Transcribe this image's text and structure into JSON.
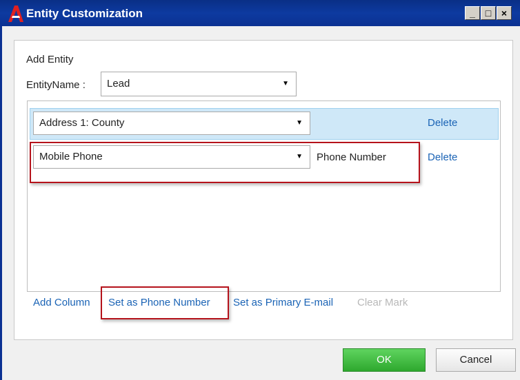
{
  "window": {
    "title": "Entity Customization",
    "controls": {
      "minimize": "_",
      "maximize": "□",
      "close": "×"
    }
  },
  "form": {
    "section_label": "Add Entity",
    "entity_name_label": "EntityName :",
    "entity_name_value": "Lead"
  },
  "rows": [
    {
      "field": "Address 1: County",
      "mark": "",
      "delete_label": "Delete",
      "selected": true
    },
    {
      "field": "Mobile Phone",
      "mark": "Phone Number",
      "delete_label": "Delete",
      "selected": false
    }
  ],
  "actions": {
    "add_column": "Add Column",
    "set_phone": "Set as Phone Number",
    "set_email": "Set as Primary E-mail",
    "clear_mark": "Clear Mark"
  },
  "buttons": {
    "ok": "OK",
    "cancel": "Cancel"
  },
  "colors": {
    "title_bar": "#0d3aa0",
    "selected_row": "#cfe8f8",
    "link": "#1a63b5",
    "highlight": "#b5121b",
    "ok_button": "#3cb83c"
  },
  "icons": {
    "app": "app-logo-icon",
    "dropdown": "chevron-down-icon"
  }
}
